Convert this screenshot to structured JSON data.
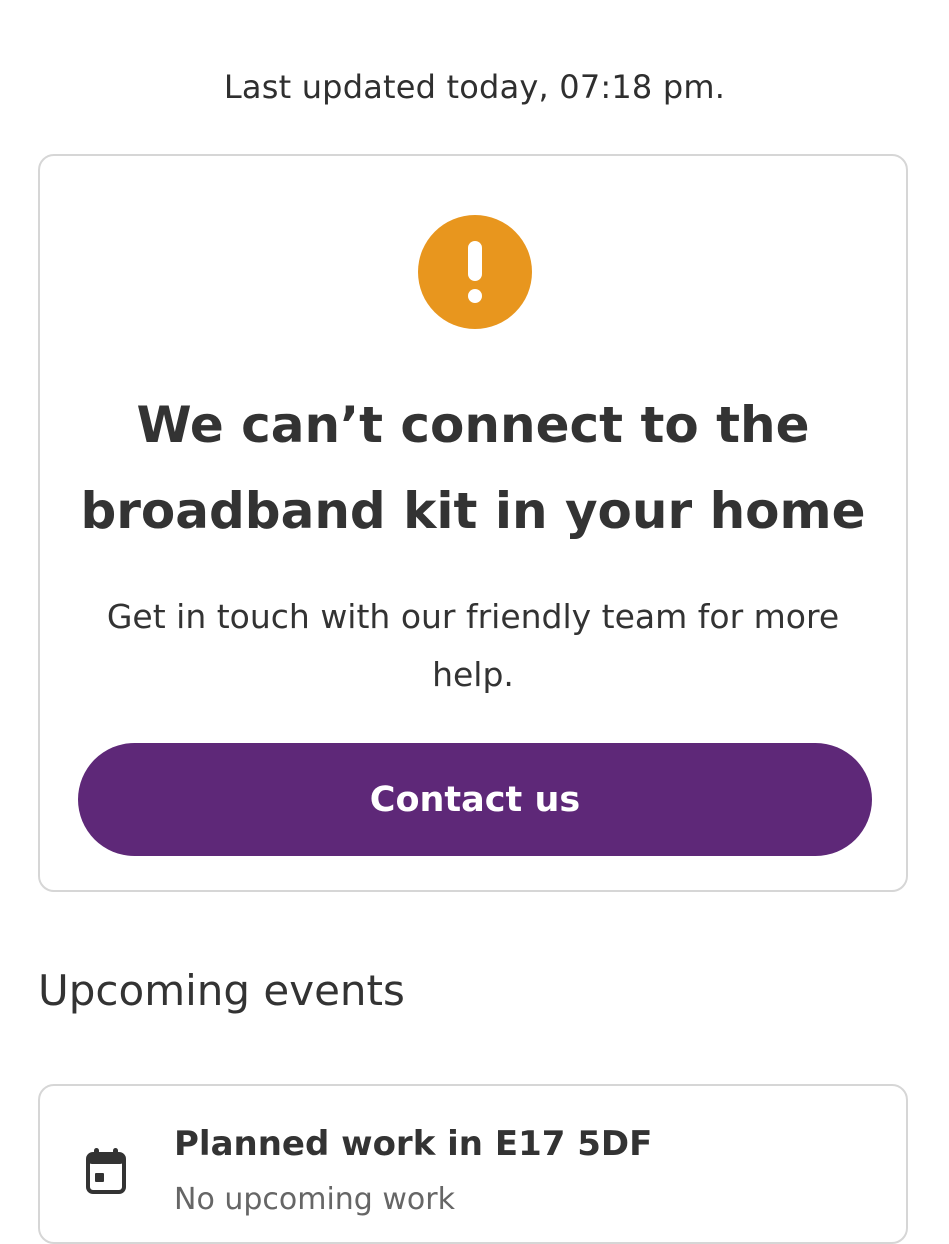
{
  "status": {
    "last_updated": "Last updated today, 07:18 pm."
  },
  "alert_card": {
    "icon": "warning-exclamation-icon",
    "icon_color": "#e8961e",
    "heading": "We can’t connect to the broadband kit in your home",
    "body": "Get in touch with our friendly team for more help.",
    "button_label": "Contact us",
    "button_color": "#5e2878"
  },
  "upcoming_events": {
    "title": "Upcoming events",
    "items": [
      {
        "icon": "calendar-icon",
        "title": "Planned work in E17 5DF",
        "subtitle": "No upcoming work"
      }
    ]
  }
}
